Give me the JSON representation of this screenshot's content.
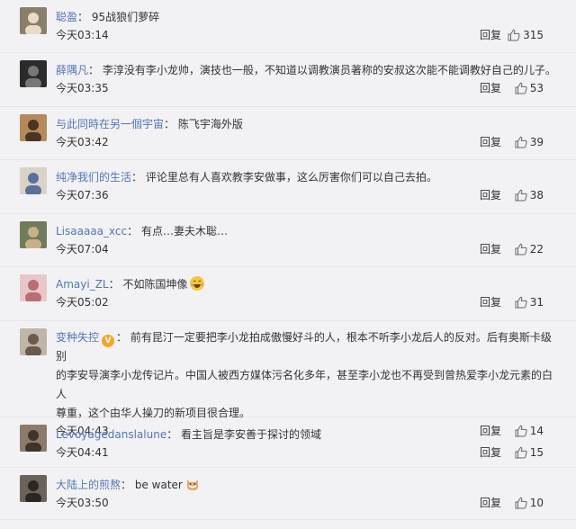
{
  "comments": [
    {
      "user": "聪盈",
      "separator": "：",
      "text": "95战狼们萝碎",
      "time": "今天03:14",
      "reply": "回复",
      "likes": "315",
      "avatar": {
        "bg": "#8a7f6b",
        "fg": "#e8dcc6"
      }
    },
    {
      "user": "薛隅凡",
      "separator": "：",
      "text": "李淳没有李小龙帅，演技也一般，不知道以调教演员著称的安叔这次能不能调教好自己的儿子。",
      "time": "今天03:35",
      "reply": "回复",
      "likes": "53",
      "avatar": {
        "bg": "#2b2b2b",
        "fg": "#777777"
      }
    },
    {
      "user": "与此同時在另一個宇宙",
      "separator": "：",
      "text": "陈飞宇海外版",
      "time": "今天03:42",
      "reply": "回复",
      "likes": "39",
      "avatar": {
        "bg": "#b58a5a",
        "fg": "#4a3424"
      }
    },
    {
      "user": "纯净我们的生活",
      "separator": "：",
      "text": "评论里总有人喜欢教李安做事，这么厉害你们可以自己去拍。",
      "time": "今天07:36",
      "reply": "回复",
      "likes": "38",
      "avatar": {
        "bg": "#d9d3c7",
        "fg": "#5a6f9e"
      }
    },
    {
      "user": "Lisaaaaa_xcc",
      "separator": "：",
      "text": "有点…妻夫木聡…",
      "time": "今天07:04",
      "reply": "回复",
      "likes": "22",
      "avatar": {
        "bg": "#6f7c5a",
        "fg": "#c9b08a"
      }
    },
    {
      "user": "Amayi_ZL",
      "separator": "：",
      "text": "不如陈国坤像",
      "time": "今天05:02",
      "reply": "回复",
      "likes": "31",
      "emoji": "laugh-emoji",
      "avatar": {
        "bg": "#e9c7c8",
        "fg": "#b96d74"
      }
    },
    {
      "user": "变种失控",
      "separator": "：",
      "badge": "V",
      "text": "前有昆汀一定要把李小龙拍成傲慢好斗的人，根本不听李小龙后人的反对。后有奥斯卡级别的李安导演李小龙传记片。中国人被西方媒体污名化多年，甚至李小龙也不再受到曾热爱李小龙元素的白人尊重，这个由华人操刀的新项目很合理。",
      "text_lines": [
        "前有昆汀一定要把李小龙拍成傲慢好斗的人，根本不听李小龙后人的反对。后有奥斯卡级别",
        "的李安导演李小龙传记片。中国人被西方媒体污名化多年，甚至李小龙也不再受到曾热爱李小龙元素的白人",
        "尊重，这个由华人操刀的新项目很合理。"
      ],
      "time": "今天04:43",
      "reply": "回复",
      "likes": "14",
      "avatar": {
        "bg": "#bfb6a8",
        "fg": "#6b5b4b"
      }
    },
    {
      "user": "Levoyagedanslalune",
      "separator": "：",
      "text": "看主旨是李安善于探讨的领域",
      "time": "今天04:41",
      "reply": "回复",
      "likes": "15",
      "avatar": {
        "bg": "#8c7b6a",
        "fg": "#3f342b"
      }
    },
    {
      "user": "大陆上的煎熬",
      "separator": "：",
      "text": "be water",
      "time": "今天03:50",
      "reply": "回复",
      "likes": "10",
      "emoji": "cat-emoji",
      "avatar": {
        "bg": "#6b6259",
        "fg": "#2c2622"
      }
    }
  ],
  "colors": {
    "username": "#5176b8",
    "background": "#f2f2f5",
    "vip_badge": "#f4a621"
  },
  "icons": {
    "like": "thumbs-up-icon"
  }
}
